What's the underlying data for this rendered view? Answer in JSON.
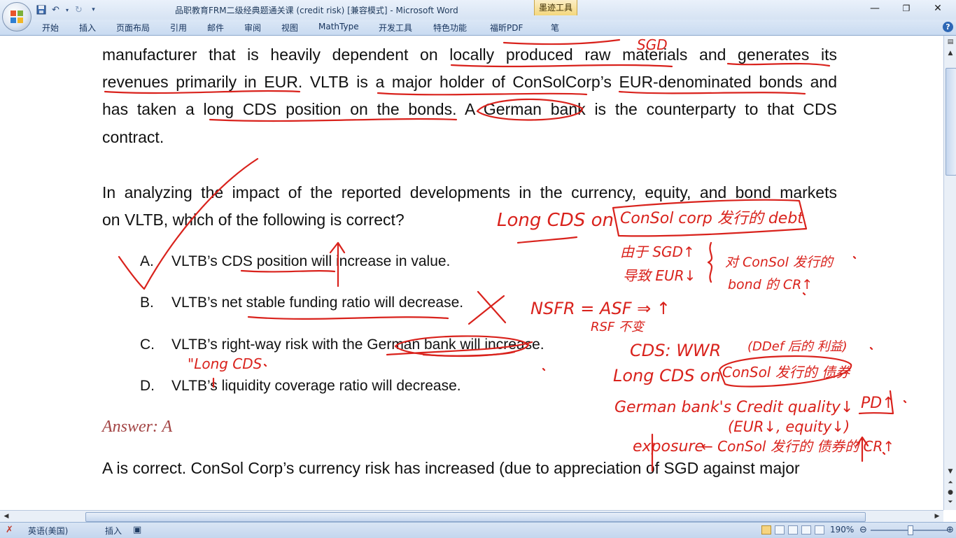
{
  "window": {
    "title": "品职教育FRM二级经典题通关课 (credit risk) [兼容模式] - Microsoft Word",
    "contextual_tab": "墨迹工具",
    "controls": {
      "minimize": "—",
      "restore": "❐",
      "close": "✕"
    }
  },
  "ribbon": {
    "tabs": [
      "开始",
      "插入",
      "页面布局",
      "引用",
      "邮件",
      "审阅",
      "视图",
      "MathType",
      "开发工具",
      "特色功能",
      "福昕PDF",
      "笔"
    ],
    "help": "?"
  },
  "document": {
    "paragraph1": [
      "manufacturer that is heavily dependent on locally produced raw materials and generates its",
      "revenues primarily in EUR. VLTB is a major holder of ConSolCorp’s EUR-denominated bonds and",
      "has taken a long CDS position on the bonds. A German bank is the counterparty to that CDS",
      "contract."
    ],
    "question": [
      "In analyzing the impact of the reported developments in the currency, equity, and bond markets",
      "on VLTB, which of the following is correct?"
    ],
    "options": [
      {
        "letter": "A.",
        "text": "VLTB’s CDS position will increase in value."
      },
      {
        "letter": "B.",
        "text": "VLTB’s net stable funding ratio will decrease."
      },
      {
        "letter": "C.",
        "text": "VLTB’s right-way risk with the German bank will increase."
      },
      {
        "letter": "D.",
        "text": "VLTB’s liquidity coverage ratio will decrease."
      }
    ],
    "answer": "Answer: A",
    "explanation": "A is correct. ConSol Corp’s currency risk has increased (due to appreciation of SGD against major"
  },
  "ink_notes": {
    "sgd_top": "SGD",
    "long_cds": "Long CDS on",
    "consol_box": "ConSol corp 发行的 debt",
    "sgd_up": "由于 SGD↑",
    "eur_down": "导致 EUR↓",
    "consol_cr": "对 ConSol 发行的",
    "bonds_cr": "bond 的 CR↑",
    "nsfr": "NSFR = ASF ⇒ ↑",
    "rsf": "RSF 不变",
    "cds_wwr": "CDS: WWR",
    "wwr_note": "(DDef 后的 利益)",
    "long_cds_consol": "Long CDS on",
    "consol_circle": "ConSol 发行的 债券",
    "german_bank": "German bank's Credit quality↓",
    "pd": "PD↑",
    "eur_equity": "(EUR↓, equity↓)",
    "exposure": "exposure",
    "consol_cr2": "← ConSol 发行的 债券的 CR↑",
    "long_cds_c": "\"Long CDS"
  },
  "statusbar": {
    "language": "英语(美国)",
    "mode": "插入",
    "zoom": "190%"
  },
  "colors": {
    "ink": "#d9221c",
    "answer": "#a34545",
    "ribbon": "#c9dbf1"
  }
}
